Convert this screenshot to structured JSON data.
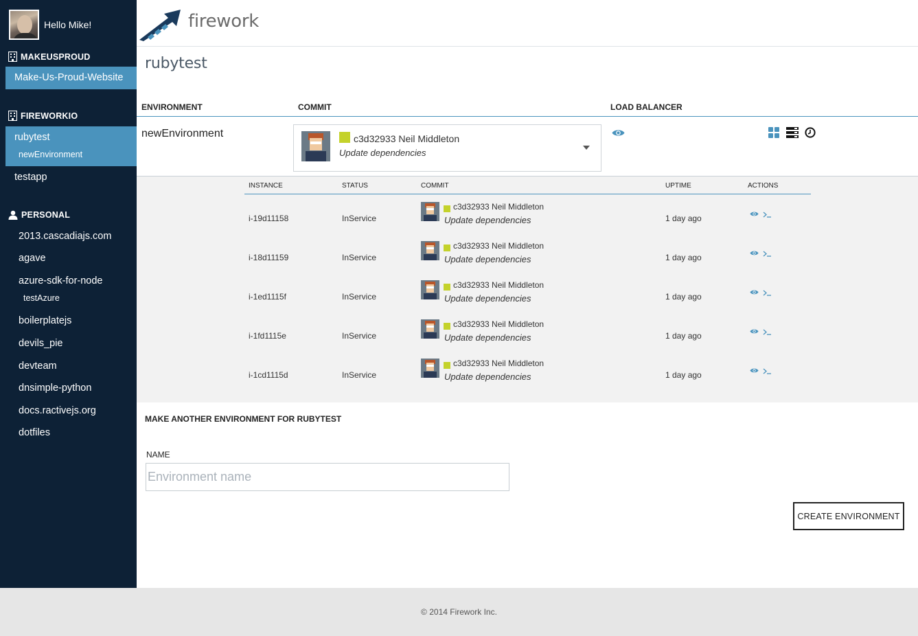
{
  "user": {
    "greeting": "Hello Mike!"
  },
  "brand": {
    "name": "firework"
  },
  "sidebar": {
    "groups": [
      {
        "title": "MAKEUSPROUD",
        "icon": "building-icon",
        "items": [
          {
            "label": "Make-Us-Proud-Website",
            "active": true
          }
        ]
      },
      {
        "title": "FIREWORKIO",
        "icon": "building-icon",
        "items": [
          {
            "label": "rubytest",
            "active": true,
            "sub": [
              "newEnvironment"
            ]
          },
          {
            "label": "testapp"
          }
        ]
      },
      {
        "title": "PERSONAL",
        "icon": "user-icon",
        "items": [
          {
            "label": "2013.cascadiajs.com"
          },
          {
            "label": "agave"
          },
          {
            "label": "azure-sdk-for-node",
            "sub": [
              "testAzure"
            ]
          },
          {
            "label": "boilerplatejs"
          },
          {
            "label": "devils_pie"
          },
          {
            "label": "devteam"
          },
          {
            "label": "dnsimple-python"
          },
          {
            "label": "docs.ractivejs.org"
          },
          {
            "label": "dotfiles"
          }
        ]
      }
    ]
  },
  "page": {
    "title": "rubytest"
  },
  "env_table": {
    "headers": {
      "environment": "ENVIRONMENT",
      "commit": "COMMIT",
      "load_balancer": "LOAD BALANCER"
    },
    "row": {
      "name": "newEnvironment",
      "commit": {
        "hash": "c3d32933",
        "author": "Neil Middleton",
        "label": "c3d32933 Neil Middleton",
        "message": "Update dependencies"
      }
    }
  },
  "instances": {
    "headers": {
      "instance": "INSTANCE",
      "status": "STATUS",
      "commit": "COMMIT",
      "uptime": "UPTIME",
      "actions": "ACTIONS"
    },
    "rows": [
      {
        "id": "i-19d11158",
        "status": "InService",
        "commit": "c3d32933 Neil Middleton",
        "message": "Update dependencies",
        "uptime": "1 day ago"
      },
      {
        "id": "i-18d11159",
        "status": "InService",
        "commit": "c3d32933 Neil Middleton",
        "message": "Update dependencies",
        "uptime": "1 day ago"
      },
      {
        "id": "i-1ed1115f",
        "status": "InService",
        "commit": "c3d32933 Neil Middleton",
        "message": "Update dependencies",
        "uptime": "1 day ago"
      },
      {
        "id": "i-1fd1115e",
        "status": "InService",
        "commit": "c3d32933 Neil Middleton",
        "message": "Update dependencies",
        "uptime": "1 day ago"
      },
      {
        "id": "i-1cd1115d",
        "status": "InService",
        "commit": "c3d32933 Neil Middleton",
        "message": "Update dependencies",
        "uptime": "1 day ago"
      }
    ],
    "action_icons": [
      "eye-icon",
      "terminal-icon"
    ]
  },
  "create_form": {
    "title": "MAKE ANOTHER ENVIRONMENT FOR RUBYTEST",
    "name_label": "NAME",
    "name_value": "",
    "name_placeholder": "Environment name",
    "submit_label": "CREATE ENVIRONMENT"
  },
  "footer": {
    "text": "© 2014 Firework Inc."
  },
  "colors": {
    "sidebar_bg": "#0d2136",
    "accent": "#4a93bd",
    "commit_swatch": "#c4d22b",
    "panel_bg": "#f2f2f2",
    "footer_bg": "#e6e6e6"
  }
}
